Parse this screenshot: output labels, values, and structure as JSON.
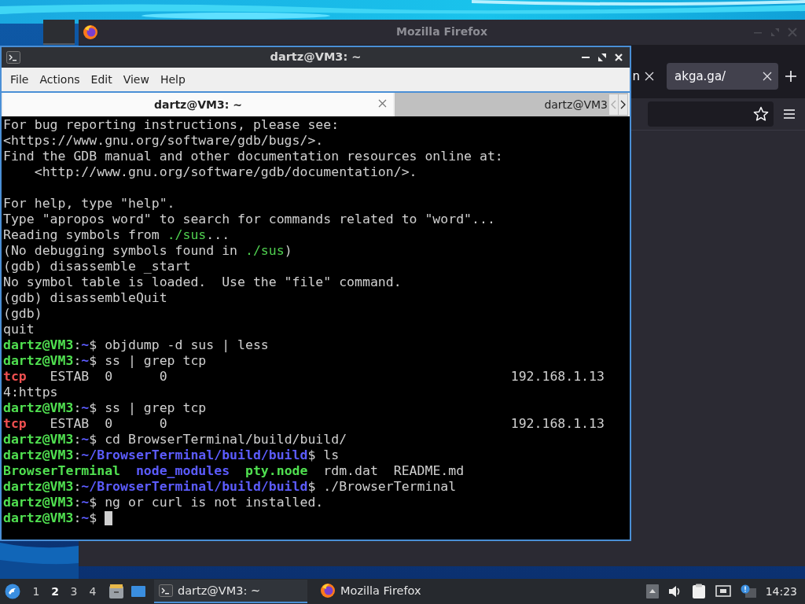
{
  "firefox_window": {
    "title": "Mozilla Firefox",
    "tabs": [
      {
        "label": "n",
        "selected": false
      },
      {
        "label": "akga.ga/",
        "selected": true
      }
    ]
  },
  "terminal_window": {
    "title": "dartz@VM3: ~",
    "menu": [
      "File",
      "Actions",
      "Edit",
      "View",
      "Help"
    ],
    "tabs": [
      {
        "label": "dartz@VM3: ~",
        "selected": true
      },
      {
        "label": "dartz@VM3",
        "selected": false
      }
    ],
    "lines": [
      {
        "kind": "text",
        "segments": [
          {
            "kind": "plain",
            "text": "For bug reporting instructions, please see:"
          }
        ]
      },
      {
        "kind": "text",
        "segments": [
          {
            "kind": "plain",
            "text": "<https://www.gnu.org/software/gdb/bugs/>."
          }
        ]
      },
      {
        "kind": "text",
        "segments": [
          {
            "kind": "plain",
            "text": "Find the GDB manual and other documentation resources online at:"
          }
        ]
      },
      {
        "kind": "text",
        "segments": [
          {
            "kind": "plain",
            "text": "    <http://www.gnu.org/software/gdb/documentation/>."
          }
        ]
      },
      {
        "kind": "blank"
      },
      {
        "kind": "text",
        "segments": [
          {
            "kind": "plain",
            "text": "For help, type \"help\"."
          }
        ]
      },
      {
        "kind": "text",
        "segments": [
          {
            "kind": "plain",
            "text": "Type \"apropos word\" to search for commands related to \"word\"..."
          }
        ]
      },
      {
        "kind": "text",
        "segments": [
          {
            "kind": "plain",
            "text": "Reading symbols from "
          },
          {
            "kind": "file",
            "text": "./sus"
          },
          {
            "kind": "plain",
            "text": "..."
          }
        ]
      },
      {
        "kind": "text",
        "segments": [
          {
            "kind": "plain",
            "text": "(No debugging symbols found in "
          },
          {
            "kind": "file",
            "text": "./sus"
          },
          {
            "kind": "plain",
            "text": ")"
          }
        ]
      },
      {
        "kind": "text",
        "segments": [
          {
            "kind": "plain",
            "text": "(gdb) disassemble _start"
          }
        ]
      },
      {
        "kind": "text",
        "segments": [
          {
            "kind": "plain",
            "text": "No symbol table is loaded.  Use the \"file\" command."
          }
        ]
      },
      {
        "kind": "text",
        "segments": [
          {
            "kind": "plain",
            "text": "(gdb) disassembleQuit"
          }
        ]
      },
      {
        "kind": "text",
        "segments": [
          {
            "kind": "plain",
            "text": "(gdb)"
          }
        ]
      },
      {
        "kind": "text",
        "segments": [
          {
            "kind": "plain",
            "text": "quit"
          }
        ]
      },
      {
        "kind": "text",
        "segments": [
          {
            "kind": "user",
            "text": "dartz@VM3"
          },
          {
            "kind": "plain",
            "text": ":"
          },
          {
            "kind": "dir",
            "text": "~"
          },
          {
            "kind": "plain",
            "text": "$ objdump -d sus | less"
          }
        ]
      },
      {
        "kind": "text",
        "segments": [
          {
            "kind": "user",
            "text": "dartz@VM3"
          },
          {
            "kind": "plain",
            "text": ":"
          },
          {
            "kind": "dir",
            "text": "~"
          },
          {
            "kind": "plain",
            "text": "$ ss | grep tcp"
          }
        ]
      },
      {
        "kind": "text",
        "segments": [
          {
            "kind": "error",
            "text": "tcp"
          },
          {
            "kind": "plain",
            "text": "   ESTAB  0      0                                            192.168.1.13"
          }
        ]
      },
      {
        "kind": "text",
        "segments": [
          {
            "kind": "plain",
            "text": "4:https"
          }
        ]
      },
      {
        "kind": "text",
        "segments": [
          {
            "kind": "user",
            "text": "dartz@VM3"
          },
          {
            "kind": "plain",
            "text": ":"
          },
          {
            "kind": "dir",
            "text": "~"
          },
          {
            "kind": "plain",
            "text": "$ ss | grep tcp"
          }
        ]
      },
      {
        "kind": "text",
        "segments": [
          {
            "kind": "error",
            "text": "tcp"
          },
          {
            "kind": "plain",
            "text": "   ESTAB  0      0                                            192.168.1.13"
          }
        ]
      },
      {
        "kind": "text",
        "segments": [
          {
            "kind": "user",
            "text": "dartz@VM3"
          },
          {
            "kind": "plain",
            "text": ":"
          },
          {
            "kind": "dir",
            "text": "~"
          },
          {
            "kind": "plain",
            "text": "$ cd BrowserTerminal/build/build/"
          }
        ]
      },
      {
        "kind": "text",
        "segments": [
          {
            "kind": "user",
            "text": "dartz@VM3"
          },
          {
            "kind": "plain",
            "text": ":"
          },
          {
            "kind": "dir",
            "text": "~/BrowserTerminal/build/build"
          },
          {
            "kind": "plain",
            "text": "$ ls"
          }
        ]
      },
      {
        "kind": "text",
        "segments": [
          {
            "kind": "user",
            "text": "BrowserTerminal"
          },
          {
            "kind": "dir",
            "text": "  node_modules"
          },
          {
            "kind": "user",
            "text": "  pty.node"
          },
          {
            "kind": "plain",
            "text": "  rdm.dat  README.md"
          }
        ]
      },
      {
        "kind": "text",
        "segments": [
          {
            "kind": "user",
            "text": "dartz@VM3"
          },
          {
            "kind": "plain",
            "text": ":"
          },
          {
            "kind": "dir",
            "text": "~/BrowserTerminal/build/build"
          },
          {
            "kind": "plain",
            "text": "$ ./BrowserTerminal"
          }
        ]
      },
      {
        "kind": "text",
        "segments": [
          {
            "kind": "user",
            "text": "dartz@VM3"
          },
          {
            "kind": "plain",
            "text": ":"
          },
          {
            "kind": "dir",
            "text": "~"
          },
          {
            "kind": "plain",
            "text": "$ ng or curl is not installed."
          }
        ]
      },
      {
        "kind": "prompt",
        "segments": [
          {
            "kind": "user",
            "text": "dartz@VM3"
          },
          {
            "kind": "plain",
            "text": ":"
          },
          {
            "kind": "dir",
            "text": "~"
          },
          {
            "kind": "plain",
            "text": "$ "
          }
        ]
      }
    ]
  },
  "taskbar": {
    "workspaces": [
      {
        "label": "1",
        "selected": false
      },
      {
        "label": "2",
        "selected": true
      },
      {
        "label": "3",
        "selected": false
      },
      {
        "label": "4",
        "selected": false
      }
    ],
    "tasks": [
      {
        "kind": "terminal",
        "label": "dartz@VM3: ~",
        "selected": true
      },
      {
        "kind": "firefox",
        "label": "Mozilla Firefox",
        "selected": false
      }
    ],
    "clock": "14:23"
  }
}
